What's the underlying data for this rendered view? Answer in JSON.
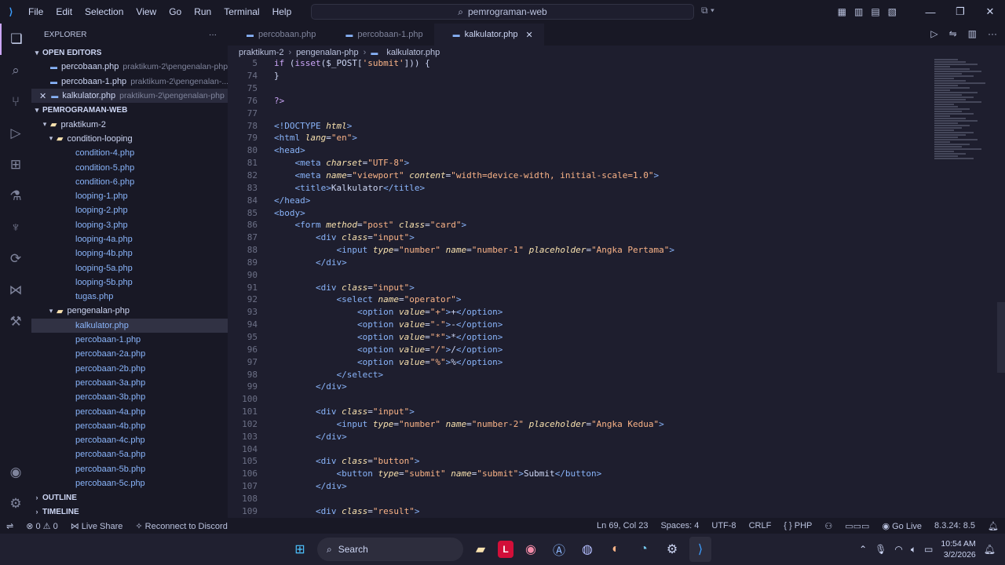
{
  "titlebar": {
    "menus": [
      "File",
      "Edit",
      "Selection",
      "View",
      "Go",
      "Run",
      "Terminal",
      "Help"
    ],
    "search_text": "pemrograman-web"
  },
  "sidebar": {
    "title": "EXPLORER",
    "open_editors_label": "OPEN EDITORS",
    "open_editors": [
      {
        "name": "percobaan.php",
        "path": "praktikum-2\\pengenalan-php"
      },
      {
        "name": "percobaan-1.php",
        "path": "praktikum-2\\pengenalan-..."
      },
      {
        "name": "kalkulator.php",
        "path": "praktikum-2\\pengenalan-php"
      }
    ],
    "workspace_label": "PEMROGRAMAN-WEB",
    "folder_praktikum": "praktikum-2",
    "folder_condition": "condition-looping",
    "condition_files": [
      "condition-4.php",
      "condition-5.php",
      "condition-6.php",
      "looping-1.php",
      "looping-2.php",
      "looping-3.php",
      "looping-4a.php",
      "looping-4b.php",
      "looping-5a.php",
      "looping-5b.php",
      "tugas.php"
    ],
    "folder_pengenalan": "pengenalan-php",
    "pengenalan_files": [
      "kalkulator.php",
      "percobaan-1.php",
      "percobaan-2a.php",
      "percobaan-2b.php",
      "percobaan-3a.php",
      "percobaan-3b.php",
      "percobaan-4a.php",
      "percobaan-4b.php",
      "percobaan-4c.php",
      "percobaan-5a.php",
      "percobaan-5b.php",
      "percobaan-5c.php"
    ],
    "outline_label": "OUTLINE",
    "timeline_label": "TIMELINE"
  },
  "tabs": [
    {
      "label": "percobaan.php"
    },
    {
      "label": "percobaan-1.php"
    },
    {
      "label": "kalkulator.php"
    }
  ],
  "breadcrumb": [
    "praktikum-2",
    "pengenalan-php",
    "kalkulator.php"
  ],
  "code_lines": [
    {
      "n": "5",
      "html": "<span class='k'>if</span> (<span class='k'>isset</span>($_POST[<span class='s2'>'submit'</span>])) {"
    },
    {
      "n": "74",
      "html": "}"
    },
    {
      "n": "75",
      "html": ""
    },
    {
      "n": "76",
      "html": "<span class='k'>?&gt;</span>"
    },
    {
      "n": "77",
      "html": ""
    },
    {
      "n": "78",
      "html": "<span class='t'>&lt;!DOCTYPE</span> <span class='a'>html</span><span class='t'>&gt;</span>"
    },
    {
      "n": "79",
      "html": "<span class='t'>&lt;html</span> <span class='a'>lang</span>=<span class='s2'>\"en\"</span><span class='t'>&gt;</span>"
    },
    {
      "n": "80",
      "html": "<span class='t'>&lt;head&gt;</span>"
    },
    {
      "n": "81",
      "html": "    <span class='t'>&lt;meta</span> <span class='a'>charset</span>=<span class='s2'>\"UTF-8\"</span><span class='t'>&gt;</span>"
    },
    {
      "n": "82",
      "html": "    <span class='t'>&lt;meta</span> <span class='a'>name</span>=<span class='s2'>\"viewport\"</span> <span class='a'>content</span>=<span class='s2'>\"width=device-width, initial-scale=1.0\"</span><span class='t'>&gt;</span>"
    },
    {
      "n": "83",
      "html": "    <span class='t'>&lt;title&gt;</span>Kalkulator<span class='t'>&lt;/title&gt;</span>"
    },
    {
      "n": "84",
      "html": "<span class='t'>&lt;/head&gt;</span>"
    },
    {
      "n": "85",
      "html": "<span class='t'>&lt;body&gt;</span>"
    },
    {
      "n": "86",
      "html": "    <span class='t'>&lt;form</span> <span class='a'>method</span>=<span class='s2'>\"post\"</span> <span class='a'>class</span>=<span class='s2'>\"card\"</span><span class='t'>&gt;</span>"
    },
    {
      "n": "87",
      "html": "        <span class='t'>&lt;div</span> <span class='a'>class</span>=<span class='s2'>\"input\"</span><span class='t'>&gt;</span>"
    },
    {
      "n": "88",
      "html": "            <span class='t'>&lt;input</span> <span class='a'>type</span>=<span class='s2'>\"number\"</span> <span class='a'>name</span>=<span class='s2'>\"number-1\"</span> <span class='a'>placeholder</span>=<span class='s2'>\"Angka Pertama\"</span><span class='t'>&gt;</span>"
    },
    {
      "n": "89",
      "html": "        <span class='t'>&lt;/div&gt;</span>"
    },
    {
      "n": "90",
      "html": ""
    },
    {
      "n": "91",
      "html": "        <span class='t'>&lt;div</span> <span class='a'>class</span>=<span class='s2'>\"input\"</span><span class='t'>&gt;</span>"
    },
    {
      "n": "92",
      "html": "            <span class='t'>&lt;select</span> <span class='a'>name</span>=<span class='s2'>\"operator\"</span><span class='t'>&gt;</span>"
    },
    {
      "n": "93",
      "html": "                <span class='t'>&lt;option</span> <span class='a'>value</span>=<span class='s2'>\"+\"</span><span class='t'>&gt;</span>+<span class='t'>&lt;/option&gt;</span>"
    },
    {
      "n": "94",
      "html": "                <span class='t'>&lt;option</span> <span class='a'>value</span>=<span class='s2'>\"-\"</span><span class='t'>&gt;</span>-<span class='t'>&lt;/option&gt;</span>"
    },
    {
      "n": "95",
      "html": "                <span class='t'>&lt;option</span> <span class='a'>value</span>=<span class='s2'>\"*\"</span><span class='t'>&gt;</span>*<span class='t'>&lt;/option&gt;</span>"
    },
    {
      "n": "96",
      "html": "                <span class='t'>&lt;option</span> <span class='a'>value</span>=<span class='s2'>\"/\"</span><span class='t'>&gt;</span>/<span class='t'>&lt;/option&gt;</span>"
    },
    {
      "n": "97",
      "html": "                <span class='t'>&lt;option</span> <span class='a'>value</span>=<span class='s2'>\"%\"</span><span class='t'>&gt;</span>%<span class='t'>&lt;/option&gt;</span>"
    },
    {
      "n": "98",
      "html": "            <span class='t'>&lt;/select&gt;</span>"
    },
    {
      "n": "99",
      "html": "        <span class='t'>&lt;/div&gt;</span>"
    },
    {
      "n": "100",
      "html": ""
    },
    {
      "n": "101",
      "html": "        <span class='t'>&lt;div</span> <span class='a'>class</span>=<span class='s2'>\"input\"</span><span class='t'>&gt;</span>"
    },
    {
      "n": "102",
      "html": "            <span class='t'>&lt;input</span> <span class='a'>type</span>=<span class='s2'>\"number\"</span> <span class='a'>name</span>=<span class='s2'>\"number-2\"</span> <span class='a'>placeholder</span>=<span class='s2'>\"Angka Kedua\"</span><span class='t'>&gt;</span>"
    },
    {
      "n": "103",
      "html": "        <span class='t'>&lt;/div&gt;</span>"
    },
    {
      "n": "104",
      "html": ""
    },
    {
      "n": "105",
      "html": "        <span class='t'>&lt;div</span> <span class='a'>class</span>=<span class='s2'>\"button\"</span><span class='t'>&gt;</span>"
    },
    {
      "n": "106",
      "html": "            <span class='t'>&lt;button</span> <span class='a'>type</span>=<span class='s2'>\"submit\"</span> <span class='a'>name</span>=<span class='s2'>\"submit\"</span><span class='t'>&gt;</span>Submit<span class='t'>&lt;/button&gt;</span>"
    },
    {
      "n": "107",
      "html": "        <span class='t'>&lt;/div&gt;</span>"
    },
    {
      "n": "108",
      "html": ""
    },
    {
      "n": "109",
      "html": "        <span class='t'>&lt;div</span> <span class='a'>class</span>=<span class='s2'>\"result\"</span><span class='t'>&gt;</span>"
    }
  ],
  "statusbar": {
    "errors": "0",
    "warnings": "0",
    "live_share": "Live Share",
    "discord": "Reconnect to Discord",
    "cursor": "Ln 69, Col 23",
    "spaces": "Spaces: 4",
    "encoding": "UTF-8",
    "eol": "CRLF",
    "language": "PHP",
    "go_live": "Go Live",
    "php_version": "8.3.24: 8.5"
  },
  "taskbar": {
    "search_label": "Search",
    "time": "10:54 AM",
    "date": "3/2/2026"
  }
}
